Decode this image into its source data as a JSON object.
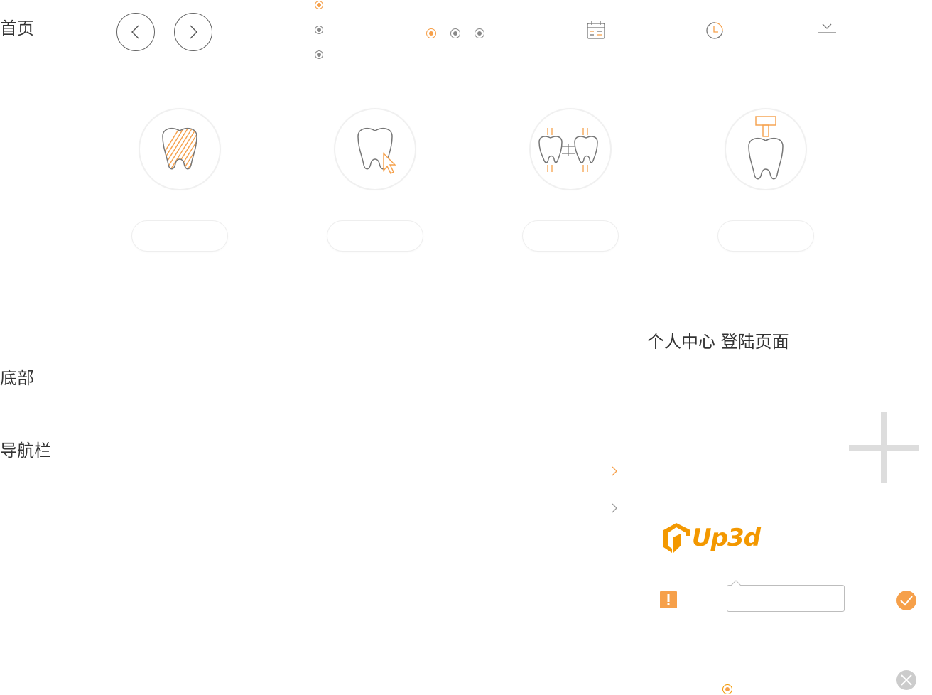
{
  "sections": {
    "home": "首页",
    "bottom": "底部",
    "navbar": "导航栏",
    "login": "个人中心 登陆页面"
  },
  "brand": {
    "logo_text": "Up3d",
    "accent_color": "#f39800"
  },
  "radio_vertical": [
    {
      "active": true
    },
    {
      "active": false
    },
    {
      "active": false
    }
  ],
  "pager_dots": [
    {
      "active": true
    },
    {
      "active": false
    },
    {
      "active": false
    }
  ],
  "header_icons": [
    "calendar-icon",
    "clock-icon",
    "download-icon"
  ],
  "tooth_steps": [
    {
      "icon": "tooth-hatched-icon",
      "label": ""
    },
    {
      "icon": "tooth-cursor-icon",
      "label": ""
    },
    {
      "icon": "tooth-pair-icon",
      "label": ""
    },
    {
      "icon": "tooth-hammer-icon",
      "label": ""
    }
  ],
  "colors": {
    "orange": "#f6a04a",
    "grey_line": "#e8e8e8",
    "success": "#f6a04a",
    "close": "#cccccc"
  }
}
